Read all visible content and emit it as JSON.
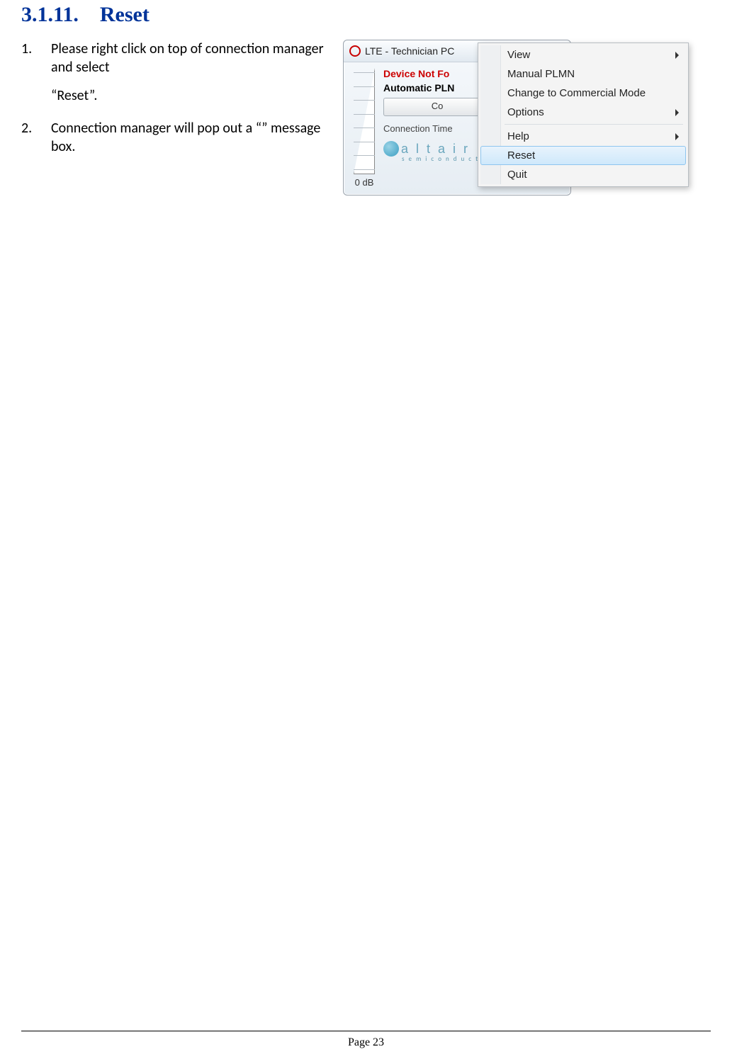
{
  "heading": {
    "number": "3.1.11.",
    "title": "Reset"
  },
  "steps": [
    {
      "text": "Please right click on top of connection manager and select",
      "quoted": "“Reset”."
    },
    {
      "text": "Connection manager will pop out a “” message box."
    }
  ],
  "app": {
    "title": "LTE - Technician PC",
    "device_status": "Device Not Fo",
    "plmn": "Automatic PLN",
    "connect_button": "Co",
    "connection_time_label": "Connection Time",
    "signal_db": "0 dB",
    "logo_text": "a l t a i r",
    "logo_sub": "s e m i c o n d u c t o r"
  },
  "context_menu": {
    "items": [
      {
        "label": "View",
        "submenu": true
      },
      {
        "label": "Manual PLMN"
      },
      {
        "label": "Change to Commercial Mode"
      },
      {
        "label": "Options",
        "submenu": true
      },
      {
        "separator": true
      },
      {
        "label": "Help",
        "submenu": true
      },
      {
        "label": "Reset",
        "highlighted": true
      },
      {
        "label": "Quit"
      }
    ]
  },
  "footer": {
    "page_label": "Page 23"
  }
}
